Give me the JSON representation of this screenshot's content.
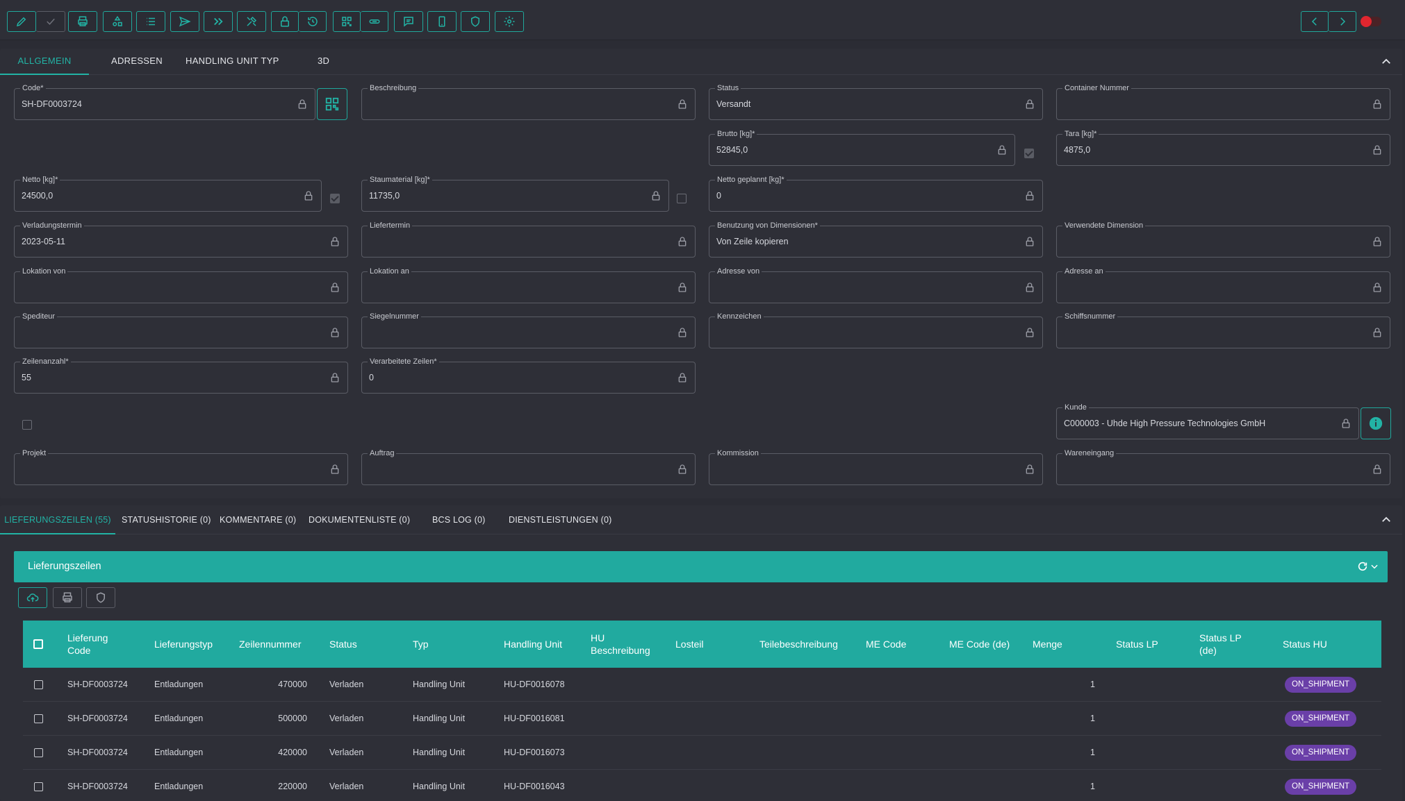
{
  "colors": {
    "accent": "#22b3a5",
    "badge": "#6a3fa8",
    "toggle": "#e0262f"
  },
  "toolbar": {
    "icons": [
      "pencil-icon",
      "check-icon",
      "printer-icon",
      "shapes-icon",
      "list-icon",
      "send-icon",
      "double-chevron-right-icon",
      "tools-icon",
      "lock-icon",
      "history-icon",
      "qr-icon",
      "link-icon",
      "comment-icon",
      "mobile-icon",
      "shield-icon",
      "gear-icon",
      "chevron-left-icon",
      "chevron-right-icon"
    ]
  },
  "tabs": [
    "ALLGEMEIN",
    "ADRESSEN",
    "HANDLING UNIT TYP",
    "3D"
  ],
  "fields": {
    "code": {
      "label": "Code*",
      "value": "SH-DF0003724"
    },
    "beschreibung": {
      "label": "Beschreibung",
      "value": ""
    },
    "status": {
      "label": "Status",
      "value": "Versandt"
    },
    "container": {
      "label": "Container Nummer",
      "value": ""
    },
    "brutto": {
      "label": "Brutto [kg]*",
      "value": "52845,0"
    },
    "tara": {
      "label": "Tara [kg]*",
      "value": "4875,0"
    },
    "netto": {
      "label": "Netto [kg]*",
      "value": "24500,0"
    },
    "staumaterial": {
      "label": "Staumaterial [kg]*",
      "value": "11735,0"
    },
    "netto_geplannt": {
      "label": "Netto geplannt [kg]*",
      "value": "0"
    },
    "verladungstermin": {
      "label": "Verladungstermin",
      "value": "2023-05-11"
    },
    "liefertermin": {
      "label": "Liefertermin",
      "value": ""
    },
    "benutzung": {
      "label": "Benutzung von Dimensionen*",
      "value": "Von Zeile kopieren"
    },
    "verwendete": {
      "label": "Verwendete Dimension",
      "value": ""
    },
    "lokation_von": {
      "label": "Lokation von",
      "value": ""
    },
    "lokation_an": {
      "label": "Lokation an",
      "value": ""
    },
    "adresse_von": {
      "label": "Adresse von",
      "value": ""
    },
    "adresse_an": {
      "label": "Adresse an",
      "value": ""
    },
    "spediteur": {
      "label": "Spediteur",
      "value": ""
    },
    "siegelnummer": {
      "label": "Siegelnummer",
      "value": ""
    },
    "kennzeichen": {
      "label": "Kennzeichen",
      "value": ""
    },
    "schiffsnummer": {
      "label": "Schiffsnummer",
      "value": ""
    },
    "zeilenanzahl": {
      "label": "Zeilenanzahl*",
      "value": "55"
    },
    "verarbeitete": {
      "label": "Verarbeitete Zeilen*",
      "value": "0"
    },
    "kunde": {
      "label": "Kunde",
      "value": "C000003 - Uhde High Pressure Technologies GmbH"
    },
    "projekt": {
      "label": "Projekt",
      "value": ""
    },
    "auftrag": {
      "label": "Auftrag",
      "value": ""
    },
    "kommission": {
      "label": "Kommission",
      "value": ""
    },
    "wareneingang": {
      "label": "Wareneingang",
      "value": ""
    }
  },
  "checkboxes": {
    "brutto": true,
    "netto": true,
    "staumaterial": false,
    "extra": false
  },
  "bottom_tabs": [
    "LIEFERUNGSZEILEN (55)",
    "STATUSHISTORIE (0)",
    "KOMMENTARE (0)",
    "DOKUMENTENLISTE (0)",
    "BCS LOG (0)",
    "DIENSTLEISTUNGEN (0)"
  ],
  "grid": {
    "title": "Lieferungszeilen",
    "columns": [
      "Lieferung Code",
      "Lieferungstyp",
      "Zeilennummer",
      "Status",
      "Typ",
      "Handling Unit",
      "HU Beschreibung",
      "Losteil",
      "Teilebeschreibung",
      "ME Code",
      "ME Code (de)",
      "Menge",
      "Status LP",
      "Status LP (de)",
      "Status HU"
    ],
    "rows": [
      [
        "SH-DF0003724",
        "Entladungen",
        "470000",
        "Verladen",
        "Handling Unit",
        "HU-DF0016078",
        "",
        "",
        "",
        "",
        "",
        "1",
        "",
        "",
        "ON_SHIPMENT"
      ],
      [
        "SH-DF0003724",
        "Entladungen",
        "500000",
        "Verladen",
        "Handling Unit",
        "HU-DF0016081",
        "",
        "",
        "",
        "",
        "",
        "1",
        "",
        "",
        "ON_SHIPMENT"
      ],
      [
        "SH-DF0003724",
        "Entladungen",
        "420000",
        "Verladen",
        "Handling Unit",
        "HU-DF0016073",
        "",
        "",
        "",
        "",
        "",
        "1",
        "",
        "",
        "ON_SHIPMENT"
      ],
      [
        "SH-DF0003724",
        "Entladungen",
        "220000",
        "Verladen",
        "Handling Unit",
        "HU-DF0016043",
        "",
        "",
        "",
        "",
        "",
        "1",
        "",
        "",
        "ON_SHIPMENT"
      ]
    ]
  }
}
